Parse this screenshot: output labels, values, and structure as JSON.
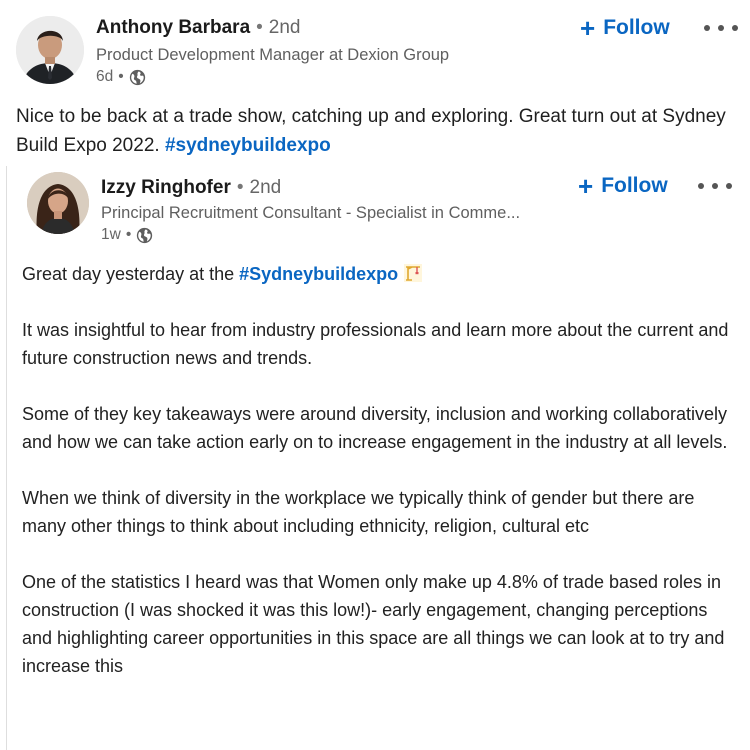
{
  "outer_post": {
    "author": {
      "name": "Anthony Barbara",
      "separator": "•",
      "degree": "2nd",
      "headline": "Product Development Manager at Dexion Group",
      "time": "6d",
      "time_separator": "•",
      "visibility_icon": "globe-icon"
    },
    "follow_label": "Follow",
    "more_icon": "more-options-icon",
    "text": "Nice to be back at a trade show, catching up and exploring. Great turn out at Sydney Build Expo 2022. ",
    "hashtag": "#sydneybuildexpo"
  },
  "inner_post": {
    "author": {
      "name": "Izzy Ringhofer",
      "separator": "•",
      "degree": "2nd",
      "headline": "Principal Recruitment Consultant - Specialist in Comme...",
      "time": "1w",
      "time_separator": "•",
      "visibility_icon": "globe-icon"
    },
    "follow_label": "Follow",
    "more_icon": "more-options-icon",
    "intro_prefix": "Great day yesterday at the ",
    "intro_hashtag": "#Sydneybuildexpo",
    "intro_icon": "construction-crane-icon",
    "paragraphs": [
      "It was insightful to hear from industry professionals and learn more about the current and future construction news and trends.",
      "Some of they key takeaways were around diversity, inclusion and working collaboratively and how we can take action early on to increase engagement in the industry at all levels.",
      "When we think of diversity in the workplace we typically think of gender but there are many other things to think about including ethnicity, religion, cultural etc",
      "One of the statistics I heard was that Women only make up 4.8% of trade based roles in construction (I was shocked it was this low!)- early engagement, changing perceptions and highlighting career opportunities in this space are all things we can look at to try and increase this"
    ]
  },
  "colors": {
    "accent": "#0a66c2",
    "text": "#1f1f1f",
    "muted": "#666666"
  }
}
